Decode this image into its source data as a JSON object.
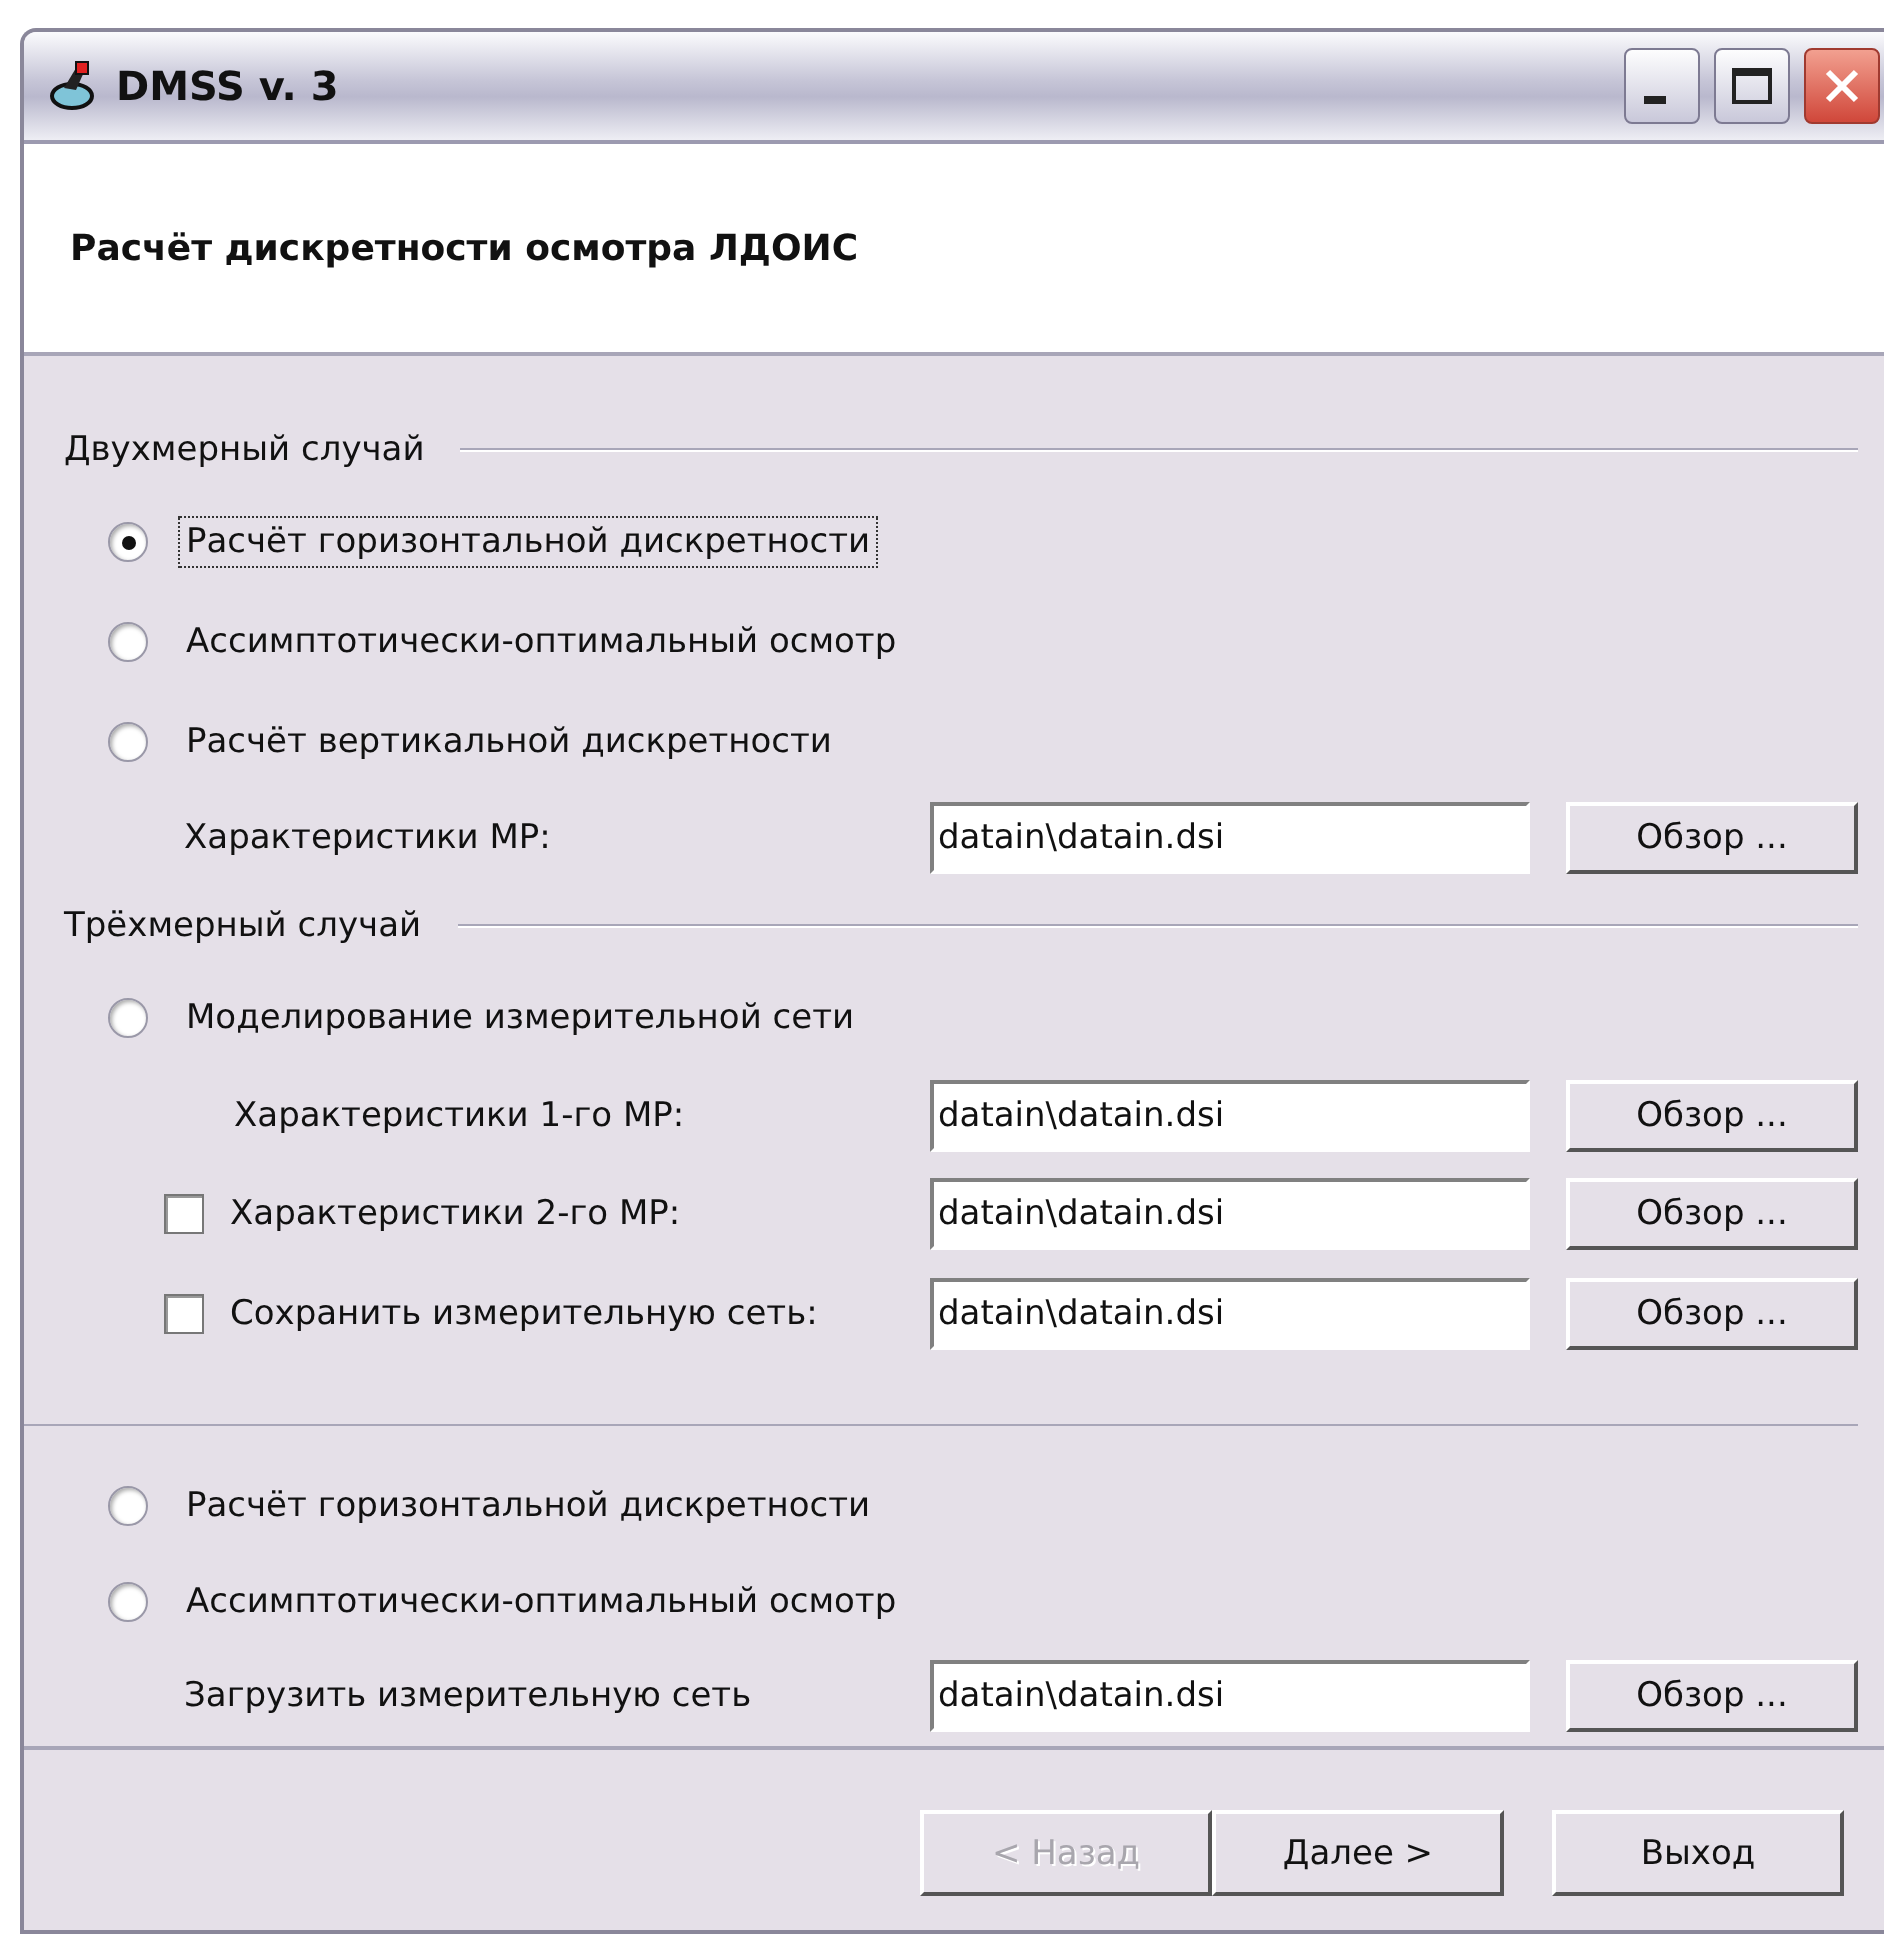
{
  "window": {
    "title": "DMSS v. 3"
  },
  "header": {
    "title": "Расчёт дискретности осмотра ЛДОИС"
  },
  "groups": [
    {
      "label": "Двухмерный случай",
      "rows": [
        {
          "kind": "radio",
          "label": "Расчёт горизонтальной дискретности",
          "selected": true,
          "focused": true
        },
        {
          "kind": "radio",
          "label": "Ассимптотически-оптимальный осмотр",
          "selected": false,
          "focused": false
        },
        {
          "kind": "radio",
          "label": "Расчёт вертикальной дискретности",
          "selected": false,
          "focused": false
        },
        {
          "kind": "file",
          "label": "Характеристики МР:",
          "value": "datain\\datain.dsi",
          "button": "Обзор ..."
        }
      ]
    },
    {
      "label": "Трёхмерный случай",
      "rows": [
        {
          "kind": "radio",
          "label": "Моделирование измерительной сети",
          "selected": false,
          "focused": false
        },
        {
          "kind": "file",
          "label": "Характеристики 1-го МР:",
          "value": "datain\\datain.dsi",
          "button": "Обзор ..."
        },
        {
          "kind": "checkfile",
          "label": "Характеристики 2-го МР:",
          "checked": false,
          "value": "datain\\datain.dsi",
          "button": "Обзор ..."
        },
        {
          "kind": "checkfile",
          "label": "Сохранить измерительную сеть:",
          "checked": false,
          "value": "datain\\datain.dsi",
          "button": "Обзор ..."
        }
      ]
    },
    {
      "rows": [
        {
          "kind": "radio",
          "label": "Расчёт горизонтальной дискретности",
          "selected": false,
          "focused": false
        },
        {
          "kind": "radio",
          "label": "Ассимптотически-оптимальный осмотр",
          "selected": false,
          "focused": false
        },
        {
          "kind": "file",
          "label": "Загрузить измерительную сеть",
          "value": "datain\\datain.dsi",
          "button": "Обзор ..."
        }
      ]
    }
  ],
  "footer": {
    "buttons": [
      {
        "label": "< Назад",
        "disabled": true
      },
      {
        "label": "Далее >",
        "disabled": false
      },
      {
        "label": "Выход",
        "disabled": false
      }
    ]
  }
}
